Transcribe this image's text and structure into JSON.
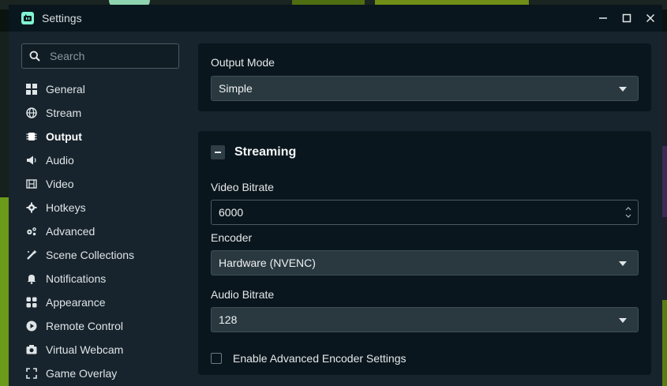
{
  "window": {
    "title": "Settings"
  },
  "search": {
    "placeholder": "Search"
  },
  "sidebar": {
    "items": [
      {
        "label": "General",
        "icon": "grid-icon"
      },
      {
        "label": "Stream",
        "icon": "globe-icon"
      },
      {
        "label": "Output",
        "icon": "chip-icon",
        "active": true
      },
      {
        "label": "Audio",
        "icon": "speaker-icon"
      },
      {
        "label": "Video",
        "icon": "film-icon"
      },
      {
        "label": "Hotkeys",
        "icon": "gear-icon"
      },
      {
        "label": "Advanced",
        "icon": "gears-icon"
      },
      {
        "label": "Scene Collections",
        "icon": "wand-icon"
      },
      {
        "label": "Notifications",
        "icon": "bell-icon"
      },
      {
        "label": "Appearance",
        "icon": "palette-icon"
      },
      {
        "label": "Remote Control",
        "icon": "play-circle-icon"
      },
      {
        "label": "Virtual Webcam",
        "icon": "camera-icon"
      },
      {
        "label": "Game Overlay",
        "icon": "expand-icon"
      }
    ]
  },
  "output_mode": {
    "label": "Output Mode",
    "value": "Simple"
  },
  "streaming": {
    "title": "Streaming",
    "video_bitrate": {
      "label": "Video Bitrate",
      "value": "6000"
    },
    "encoder": {
      "label": "Encoder",
      "value": "Hardware (NVENC)"
    },
    "audio_bitrate": {
      "label": "Audio Bitrate",
      "value": "128"
    },
    "advanced_checkbox": {
      "label": "Enable Advanced Encoder Settings",
      "checked": false
    }
  },
  "colors": {
    "accent": "#80f5d2",
    "background": "#17242d",
    "panel": "#0a161d"
  }
}
